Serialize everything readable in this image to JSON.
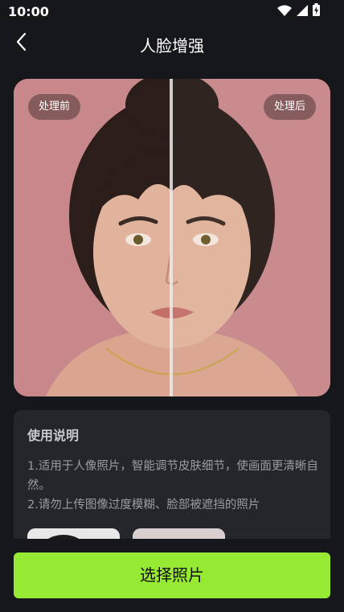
{
  "status_bar": {
    "time": "10:00",
    "icons": [
      "wifi-icon",
      "cellular-signal-icon",
      "battery-charging-icon"
    ]
  },
  "nav": {
    "back_icon": "chevron-left-icon",
    "title": "人脸增强"
  },
  "compare": {
    "before_label": "处理前",
    "after_label": "处理后",
    "split_position": 0.5
  },
  "usage": {
    "title": "使用说明",
    "line1": "1.适用于人像照片，智能调节皮肤细节，使画面更清晰自然。",
    "line2": "2.请勿上传图像过度模糊、脸部被遮挡的照片"
  },
  "action": {
    "select_label": "选择照片"
  },
  "colors": {
    "background": "#16171b",
    "card": "#24262b",
    "accent": "#96ea34",
    "photo_background": "#c8888b"
  }
}
